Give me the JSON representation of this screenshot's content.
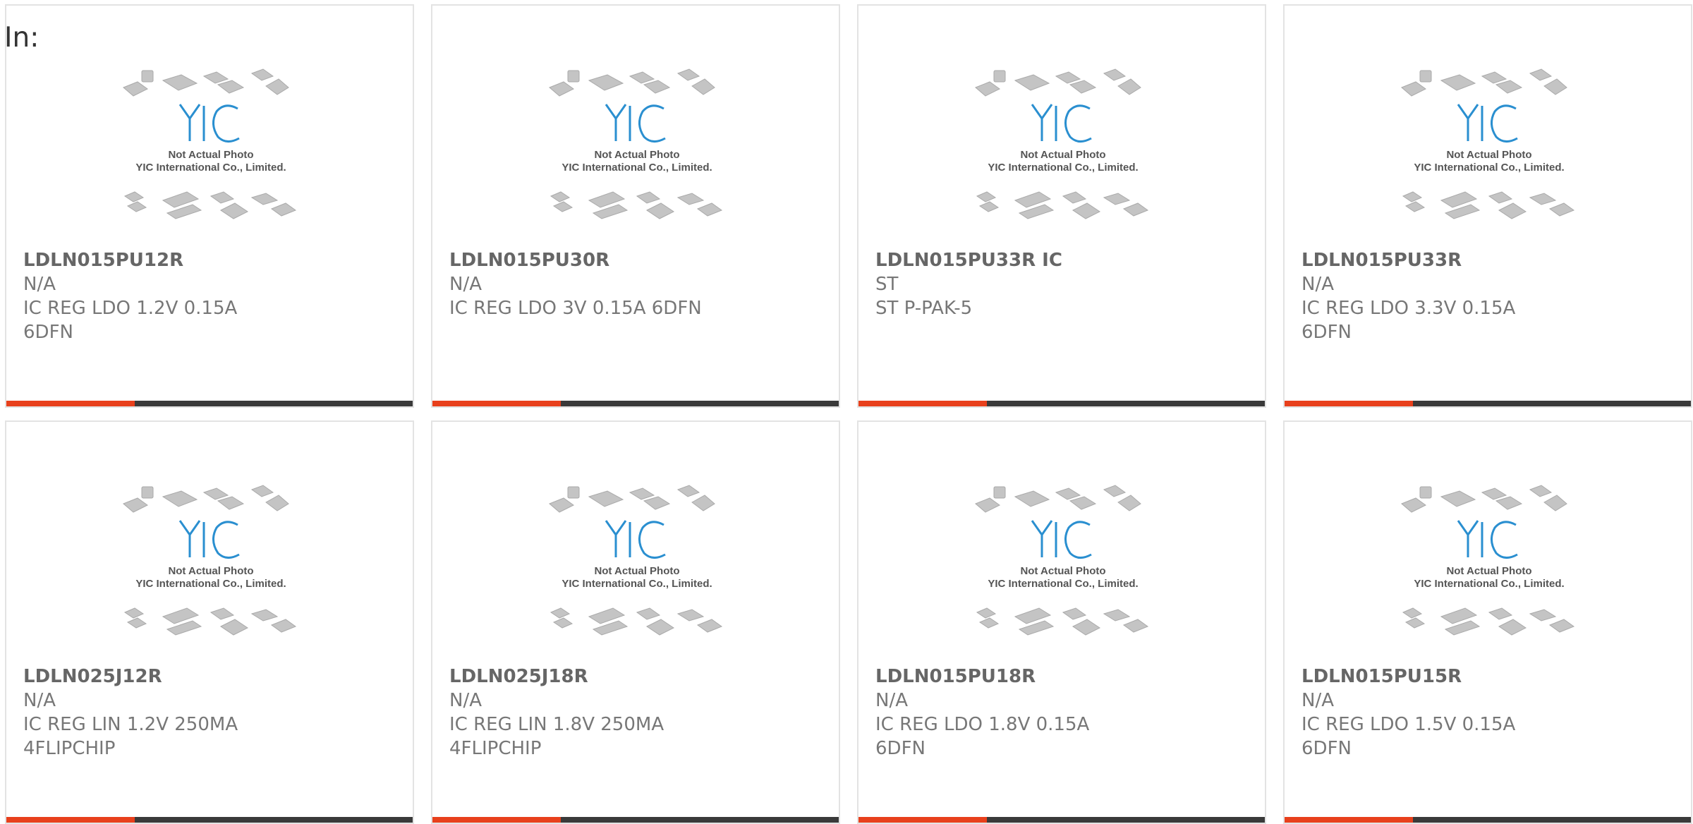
{
  "header": {
    "in_label": "In:"
  },
  "placeholder": {
    "line1": "Not Actual Photo",
    "line2": "YIC International Co., Limited.",
    "logo_text": "YIC"
  },
  "colors": {
    "accent": "#e8401c",
    "bar": "#3a3a3a",
    "logo": "#2a8fd0"
  },
  "products": [
    {
      "part": "LDLN015PU12R",
      "manufacturer": "N/A",
      "description": "IC REG LDO 1.2V 0.15A 6DFN"
    },
    {
      "part": "LDLN015PU30R",
      "manufacturer": "N/A",
      "description": "IC REG LDO 3V 0.15A 6DFN"
    },
    {
      "part": "LDLN015PU33R IC",
      "manufacturer": "ST",
      "description": "ST P-PAK-5"
    },
    {
      "part": "LDLN015PU33R",
      "manufacturer": "N/A",
      "description": "IC REG LDO 3.3V 0.15A 6DFN"
    },
    {
      "part": "LDLN025J12R",
      "manufacturer": "N/A",
      "description": "IC REG LIN 1.2V 250MA 4FLIPCHIP"
    },
    {
      "part": "LDLN025J18R",
      "manufacturer": "N/A",
      "description": "IC REG LIN 1.8V 250MA 4FLIPCHIP"
    },
    {
      "part": "LDLN015PU18R",
      "manufacturer": "N/A",
      "description": "IC REG LDO 1.8V 0.15A 6DFN"
    },
    {
      "part": "LDLN015PU15R",
      "manufacturer": "N/A",
      "description": "IC REG LDO 1.5V 0.15A 6DFN"
    }
  ]
}
